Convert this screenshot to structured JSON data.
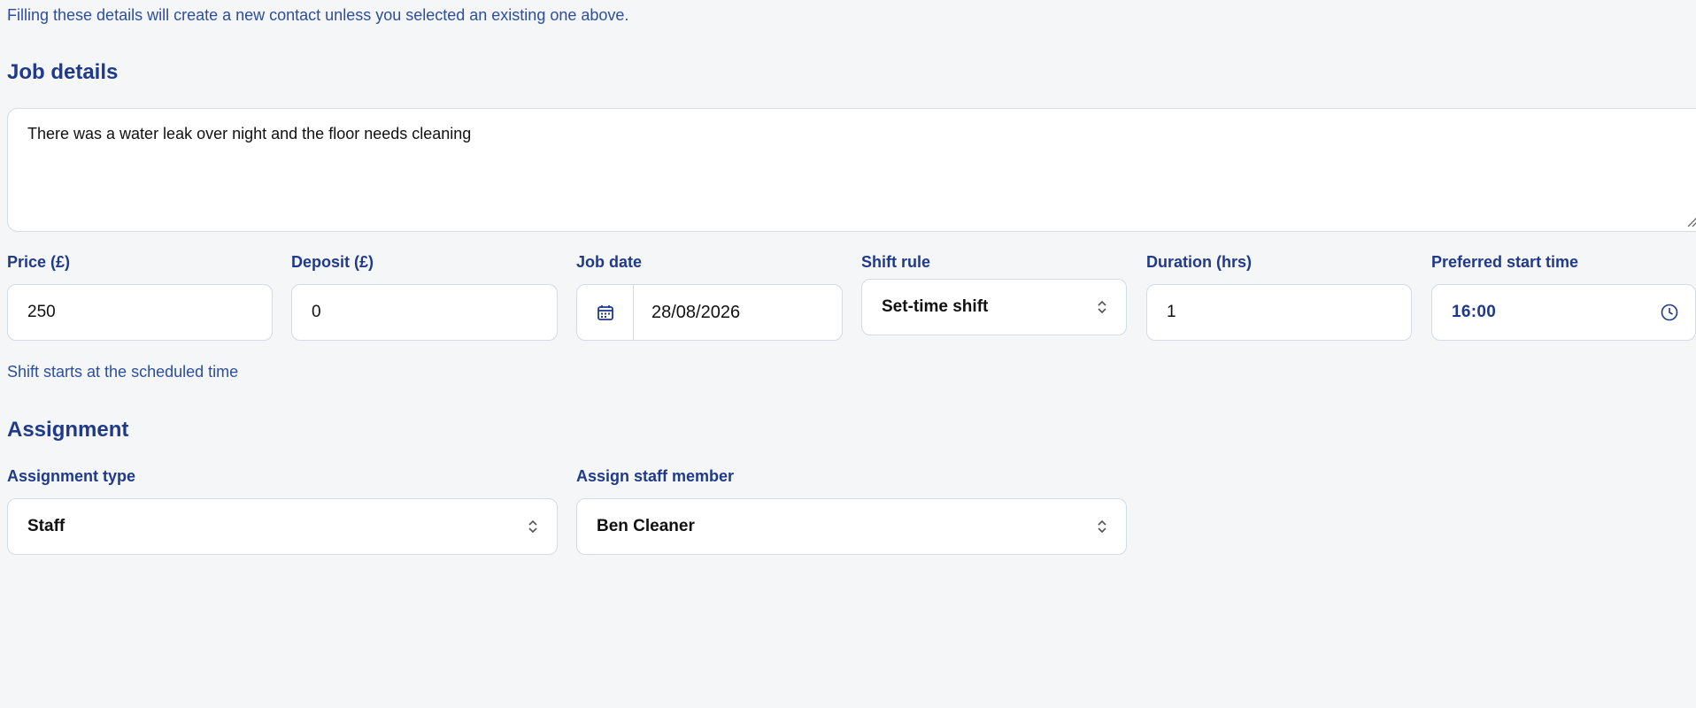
{
  "contact": {
    "hint": "Filling these details will create a new contact unless you selected an existing one above."
  },
  "job": {
    "title": "Job details",
    "description": "There was a water leak over night and the floor needs cleaning",
    "price": {
      "label": "Price (£)",
      "value": "250"
    },
    "deposit": {
      "label": "Deposit (£)",
      "value": "0"
    },
    "date": {
      "label": "Job date",
      "value": "28/08/2026"
    },
    "shift_rule": {
      "label": "Shift rule",
      "value": "Set-time shift",
      "note": "Shift starts at the scheduled time"
    },
    "duration": {
      "label": "Duration (hrs)",
      "value": "1"
    },
    "start_time": {
      "label": "Preferred start time",
      "value": "16:00"
    }
  },
  "assignment": {
    "title": "Assignment",
    "type": {
      "label": "Assignment type",
      "value": "Staff"
    },
    "staff": {
      "label": "Assign staff member",
      "value": "Ben Cleaner"
    }
  },
  "icons": {
    "calendar": "calendar-icon",
    "clock": "clock-icon",
    "chevron": "chevron-up-down-icon"
  },
  "colors": {
    "accent": "#1f3a8a",
    "background": "#f4f6f8",
    "border": "#d3dbe6"
  }
}
